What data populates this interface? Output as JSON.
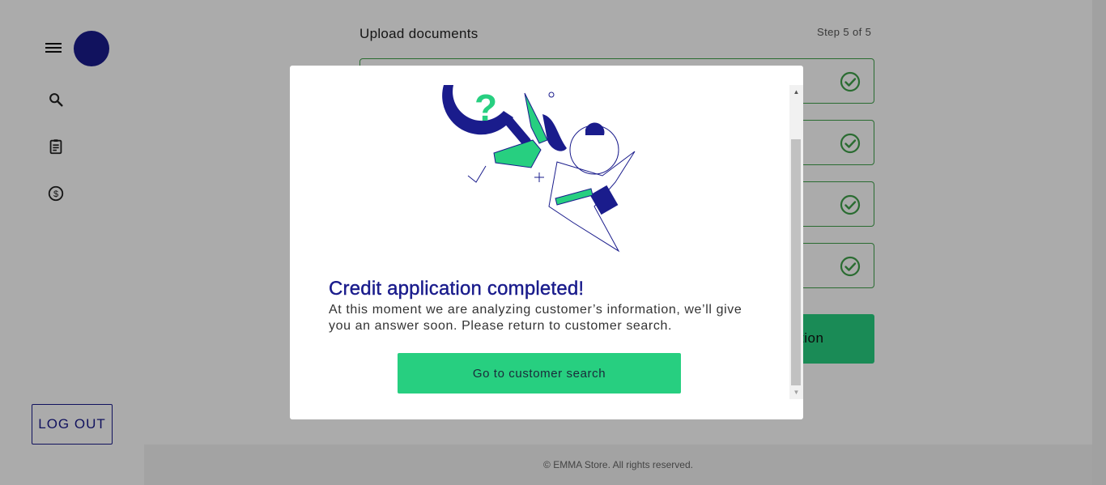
{
  "sidebar": {
    "menu_icon": "hamburger-icon",
    "nav": [
      {
        "name": "search",
        "icon": "search-icon"
      },
      {
        "name": "applications",
        "icon": "clipboard-icon"
      },
      {
        "name": "credit",
        "icon": "dollar-circle-icon"
      }
    ],
    "logout_label": "LOG OUT"
  },
  "main": {
    "title": "Upload documents",
    "step": "Step 5 of 5",
    "documents_count": 4,
    "finish_button_label": "tion"
  },
  "modal": {
    "title": "Credit application completed!",
    "message": "At this moment we are analyzing customer’s information, we’ll give you an answer soon. Please return to customer search.",
    "button_label": "Go to customer search"
  },
  "footer": {
    "text": "© EMMA Store. All rights reserved."
  },
  "colors": {
    "brand_navy": "#1a1c8c",
    "accent_green": "#27cf80",
    "check_green": "#3fa14a"
  }
}
